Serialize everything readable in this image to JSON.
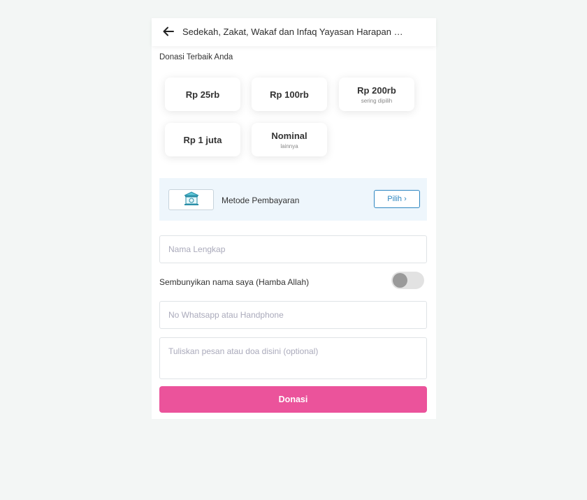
{
  "header": {
    "title": "Sedekah, Zakat, Wakaf dan Infaq Yayasan Harapan Ba..."
  },
  "donation": {
    "section_label": "Donasi Terbaik Anda",
    "options": [
      {
        "value": "Rp 25rb",
        "sub": ""
      },
      {
        "value": "Rp 100rb",
        "sub": ""
      },
      {
        "value": "Rp 200rb",
        "sub": "sering dipilih"
      },
      {
        "value": "Rp 1 juta",
        "sub": ""
      },
      {
        "value": "Nominal",
        "sub": "lainnya"
      }
    ]
  },
  "payment": {
    "label": "Metode Pembayaran",
    "button": "Pilih ›"
  },
  "form": {
    "name_placeholder": "Nama Lengkap",
    "hide_name_label": "Sembunyikan nama saya (Hamba Allah)",
    "hide_name_on": false,
    "phone_placeholder": "No Whatsapp atau Handphone",
    "message_placeholder": "Tuliskan pesan atau doa disini (optional)"
  },
  "submit": {
    "label": "Donasi"
  },
  "colors": {
    "primary": "#eb539b",
    "accent": "#2e86c1",
    "pay_bg": "#eef6fc"
  }
}
